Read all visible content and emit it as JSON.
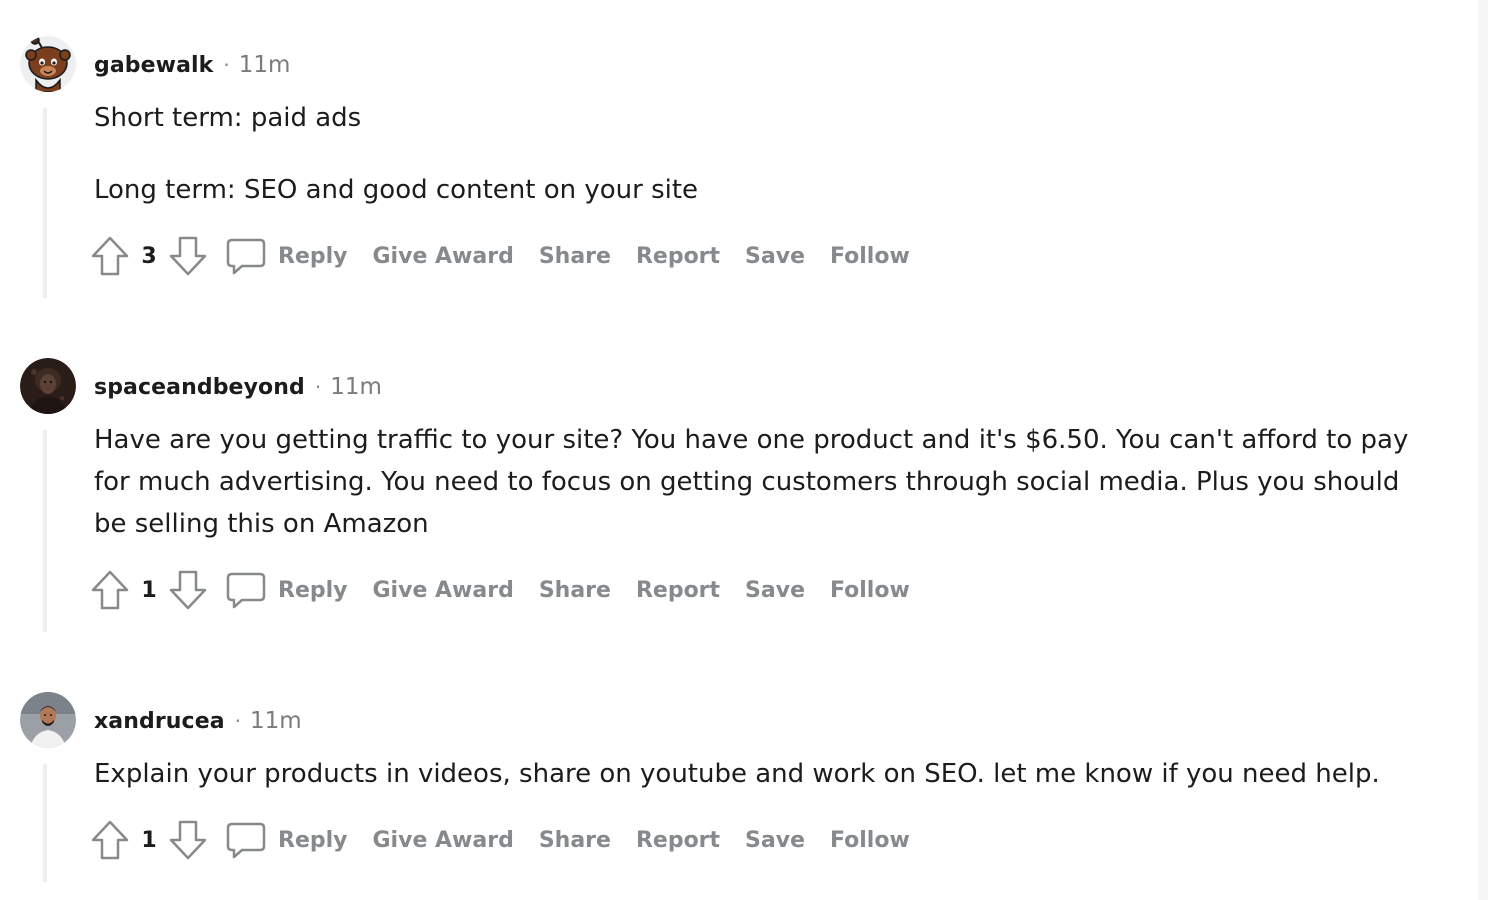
{
  "comments": [
    {
      "username": "gabewalk",
      "separator": "·",
      "time": "11m",
      "avatar_icon": "snoo-avatar-icon",
      "paragraphs": [
        "Short term: paid ads",
        "Long term: SEO and good content on your site"
      ],
      "score": "3",
      "actions": {
        "reply": "Reply",
        "give_award": "Give Award",
        "share": "Share",
        "report": "Report",
        "save": "Save",
        "follow": "Follow"
      }
    },
    {
      "username": "spaceandbeyond",
      "separator": "·",
      "time": "11m",
      "avatar_icon": "user-photo-avatar",
      "paragraphs": [
        "Have are you getting traffic to your site? You have one product and it's $6.50. You can't afford to pay for much advertising. You need to focus on getting customers through social media. Plus you should be selling this on Amazon"
      ],
      "score": "1",
      "actions": {
        "reply": "Reply",
        "give_award": "Give Award",
        "share": "Share",
        "report": "Report",
        "save": "Save",
        "follow": "Follow"
      }
    },
    {
      "username": "xandrucea",
      "separator": "·",
      "time": "11m",
      "avatar_icon": "user-photo-avatar",
      "paragraphs": [
        "Explain your products in videos, share on youtube and work on SEO. let me know if you need help."
      ],
      "score": "1",
      "actions": {
        "reply": "Reply",
        "give_award": "Give Award",
        "share": "Share",
        "report": "Report",
        "save": "Save",
        "follow": "Follow"
      }
    }
  ],
  "colors": {
    "text": "#1c1c1c",
    "meta": "#787c7e",
    "action": "#878a8c",
    "thread_line": "#edeff1"
  }
}
